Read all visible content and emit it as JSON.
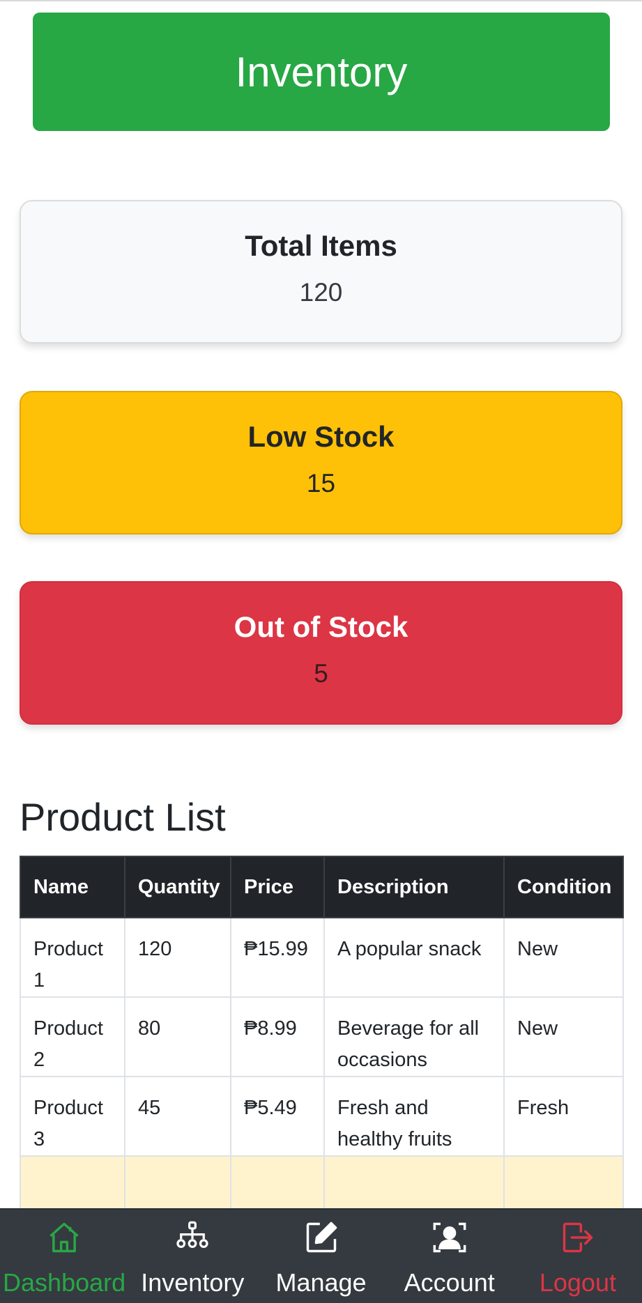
{
  "header": {
    "title": "Inventory"
  },
  "stats": {
    "total": {
      "label": "Total Items",
      "value": "120"
    },
    "low": {
      "label": "Low Stock",
      "value": "15"
    },
    "out": {
      "label": "Out of Stock",
      "value": "5"
    }
  },
  "products": {
    "title": "Product List",
    "columns": [
      "Name",
      "Quantity",
      "Price",
      "Description",
      "Condition"
    ],
    "rows": [
      {
        "name": "Product 1",
        "quantity": "120",
        "price": "₱15.99",
        "description": "A popular snack",
        "condition": "New"
      },
      {
        "name": "Product 2",
        "quantity": "80",
        "price": "₱8.99",
        "description": "Beverage for all occasions",
        "condition": "New"
      },
      {
        "name": "Product 3",
        "quantity": "45",
        "price": "₱5.49",
        "description": "Fresh and healthy fruits",
        "condition": "Fresh"
      }
    ]
  },
  "nav": {
    "items": [
      {
        "label": "Dashboard",
        "icon": "home-icon",
        "state": "active"
      },
      {
        "label": "Inventory",
        "icon": "sitemap-icon",
        "state": "normal"
      },
      {
        "label": "Manage",
        "icon": "edit-icon",
        "state": "normal"
      },
      {
        "label": "Account",
        "icon": "user-icon",
        "state": "normal"
      },
      {
        "label": "Logout",
        "icon": "logout-icon",
        "state": "danger"
      }
    ]
  },
  "colors": {
    "primary": "#28a745",
    "warning": "#ffc107",
    "danger": "#dc3545",
    "dark": "#212529",
    "nav": "#343a40"
  }
}
